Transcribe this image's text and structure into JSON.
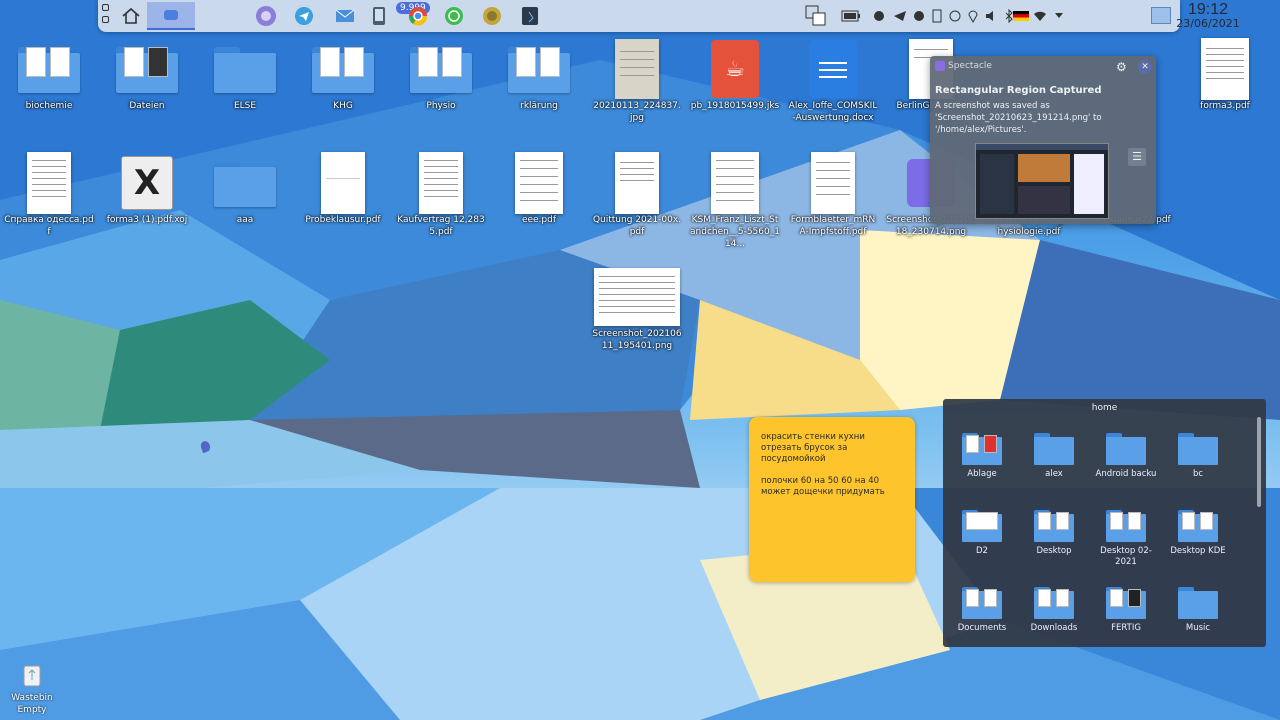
{
  "panel": {
    "badge": "9.999",
    "clock_time": "19:12",
    "clock_date": "23/06/2021",
    "colors": {
      "panel_bg": "#d7e1ee",
      "active_task": "#7896e6"
    },
    "tasks": [
      {
        "icon": "home-icon"
      },
      {
        "icon": "active-window-icon"
      },
      {
        "icon": "browser-icon"
      },
      {
        "icon": "telegram-icon"
      },
      {
        "icon": "mail-icon"
      },
      {
        "icon": "phone-icon"
      },
      {
        "icon": "chrome-icon"
      },
      {
        "icon": "whatsapp-icon"
      },
      {
        "icon": "bitcoin-icon"
      },
      {
        "icon": "terminal-icon"
      }
    ]
  },
  "desktop": {
    "row1": [
      "biochemie",
      "Dateien",
      "ELSE",
      "KHG",
      "Physio",
      "rklärung",
      "20210113_224837.jpg",
      "pb_1918015499.jks",
      "Alex_Ioffe_COMSKIL-Auswertung.docx",
      "BerlinGlobal ng",
      "forma3.pdf"
    ],
    "row2": [
      "Справка одесса.pdf",
      "forma3 (1).pdf.xoj",
      "aaa",
      "Probeklausur.pdf",
      "Kaufvertrag 12,2835.pdf",
      "eee.pdf",
      "Quittung 2021-00x.pdf",
      "KSM_Franz_Liszt_Standchen__5-5560_114...",
      "Formblaetter_mRNA-Impfstoff.pdf",
      "Screenshot_20210618_230714.png",
      "Formelsammlung Physiologie.pdf",
      "Probeklausur22.pdf"
    ],
    "row3": [
      "Screenshot_20210611_195401.png"
    ],
    "wastebin": "Wastebin\nEmpty"
  },
  "notification": {
    "app": "Spectacle",
    "title": "Rectangular Region Captured",
    "body": "A screenshot was saved as 'Screenshot_20210623_191214.png' to '/home/alex/Pictures'."
  },
  "note": {
    "line1": "окрасить стенки кухни",
    "line2": "отрезать брусок за посудомойкой",
    "line3": "полочки 60 на 50 60 на 40",
    "line4": "может дощечки придумать",
    "color": "#fdc52b"
  },
  "folderview": {
    "title": "home",
    "items": [
      "Ablage",
      "alex",
      "Android backu",
      "bc",
      "D2",
      "Desktop",
      "Desktop 02-2021",
      "Desktop KDE",
      "Documents",
      "Downloads",
      "FERTIG",
      "Music"
    ]
  }
}
